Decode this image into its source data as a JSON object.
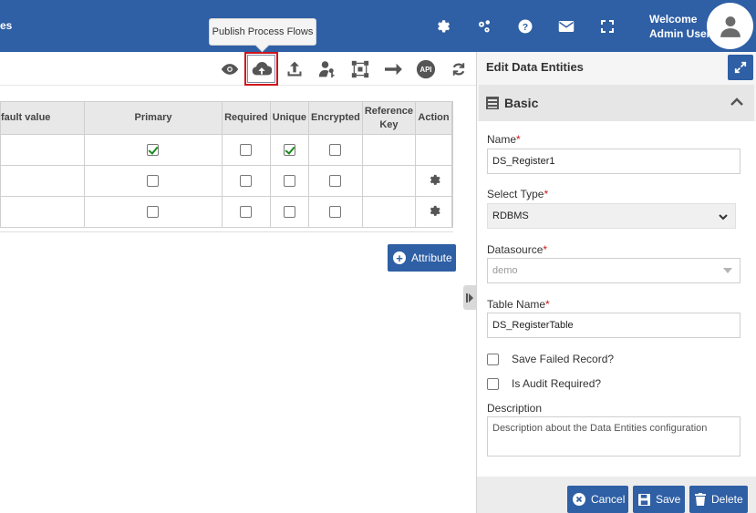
{
  "header": {
    "breadcrumb_fragment": "es",
    "welcome_line1": "Welcome",
    "welcome_line2": "Admin User",
    "icons": [
      "settings-gear-icon",
      "network-gear-icon",
      "help-icon",
      "mail-icon",
      "fullscreen-icon",
      "user-avatar-icon"
    ]
  },
  "tooltip": {
    "text": "Publish Process Flows"
  },
  "toolbar": {
    "icons": [
      "eye-icon",
      "cloud-upload-icon",
      "upload-icon",
      "user-key-icon",
      "flow-icon",
      "arrow-right-icon",
      "api-icon",
      "refresh-icon"
    ],
    "api_label": "API"
  },
  "table": {
    "columns": [
      "fault value",
      "Primary",
      "Required",
      "Unique",
      "Encrypted",
      "Reference Key",
      "Action"
    ],
    "rows": [
      {
        "primary": true,
        "required": false,
        "unique": true,
        "encrypted": false,
        "action": false
      },
      {
        "primary": false,
        "required": false,
        "unique": false,
        "encrypted": false,
        "action": true
      },
      {
        "primary": false,
        "required": false,
        "unique": false,
        "encrypted": false,
        "action": true
      }
    ]
  },
  "attribute_button": "Attribute",
  "panel": {
    "title": "Edit Data Entities",
    "section": "Basic",
    "name_label": "Name",
    "name_value": "DS_Register1",
    "type_label": "Select Type",
    "type_value": "RDBMS",
    "datasource_label": "Datasource",
    "datasource_value": "demo",
    "table_label": "Table Name",
    "table_value": "DS_RegisterTable",
    "save_failed_label": "Save Failed Record?",
    "audit_label": "Is Audit Required?",
    "description_label": "Description",
    "description_value": "Description about the Data Entities configuration",
    "required_mark": "*",
    "buttons": {
      "cancel": "Cancel",
      "save": "Save",
      "delete": "Delete"
    }
  },
  "colors": {
    "brand": "#2f5fa4",
    "highlight": "#d0141a",
    "check": "#1a8a1a"
  }
}
